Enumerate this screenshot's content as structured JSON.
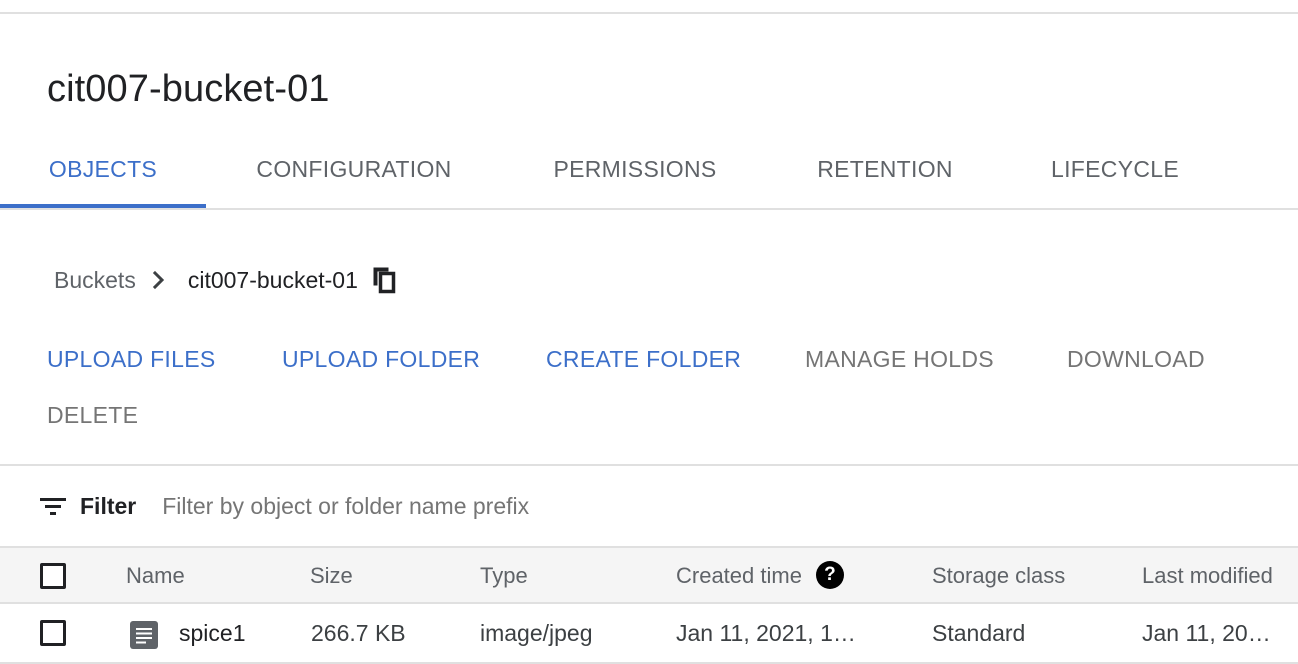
{
  "bucket": {
    "title": "cit007-bucket-01"
  },
  "tabs": [
    {
      "label": "OBJECTS",
      "active": true
    },
    {
      "label": "CONFIGURATION",
      "active": false
    },
    {
      "label": "PERMISSIONS",
      "active": false
    },
    {
      "label": "RETENTION",
      "active": false
    },
    {
      "label": "LIFECYCLE",
      "active": false
    }
  ],
  "breadcrumb": {
    "root": "Buckets",
    "current": "cit007-bucket-01",
    "separator_icon": "chevron-right-icon",
    "copy_icon": "copy-icon"
  },
  "actions": {
    "upload_files": "UPLOAD FILES",
    "upload_folder": "UPLOAD FOLDER",
    "create_folder": "CREATE FOLDER",
    "manage_holds": "MANAGE HOLDS",
    "download": "DOWNLOAD",
    "delete": "DELETE"
  },
  "filter": {
    "label": "Filter",
    "placeholder": "Filter by object or folder name prefix",
    "icon": "filter-list-icon"
  },
  "table": {
    "columns": {
      "name": "Name",
      "size": "Size",
      "type": "Type",
      "created": "Created time",
      "storage": "Storage class",
      "modified": "Last modified"
    },
    "help_icon": "help-icon",
    "rows": [
      {
        "name": "spice1",
        "size": "266.7 KB",
        "type": "image/jpeg",
        "created": "Jan 11, 2021, 1…",
        "storage": "Standard",
        "modified": "Jan 11, 20…",
        "icon": "file-document-icon"
      }
    ]
  },
  "colors": {
    "accent": "#3c6fc9",
    "text_primary": "#202124",
    "text_secondary": "#5f6368",
    "disabled": "#757575",
    "divider": "#e0e0e0",
    "header_bg": "#f5f5f5"
  }
}
